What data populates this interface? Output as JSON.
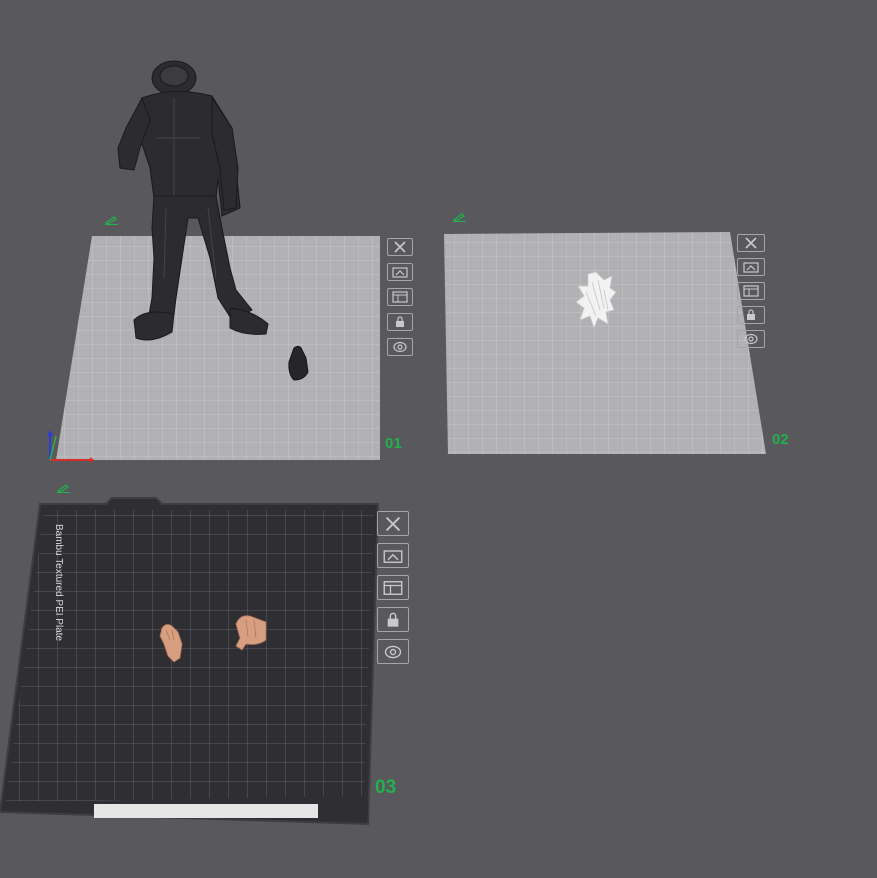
{
  "plates": [
    {
      "number": "01",
      "style": "cool"
    },
    {
      "number": "02",
      "style": "cool"
    },
    {
      "number": "03",
      "style": "textured",
      "label": "Bambu Textured PEI Plate"
    }
  ],
  "toolbar_icons": [
    "close-icon",
    "arrange-icon",
    "layout-icon",
    "lock-icon",
    "settings-icon"
  ],
  "colors": {
    "background": "#59585d",
    "plate_cool": "#b1b1b4",
    "plate_textured": "#2f2f33",
    "plate_number": "#22b14c",
    "grid_line": "#d9d9dc",
    "figure": "#2c2c2e",
    "hair": "#f2f2f2",
    "hands": "#d79e7f"
  },
  "objects": [
    "standing-figure-model",
    "small-dark-part-model",
    "white-hair-model",
    "left-hand-model",
    "right-hand-model"
  ]
}
